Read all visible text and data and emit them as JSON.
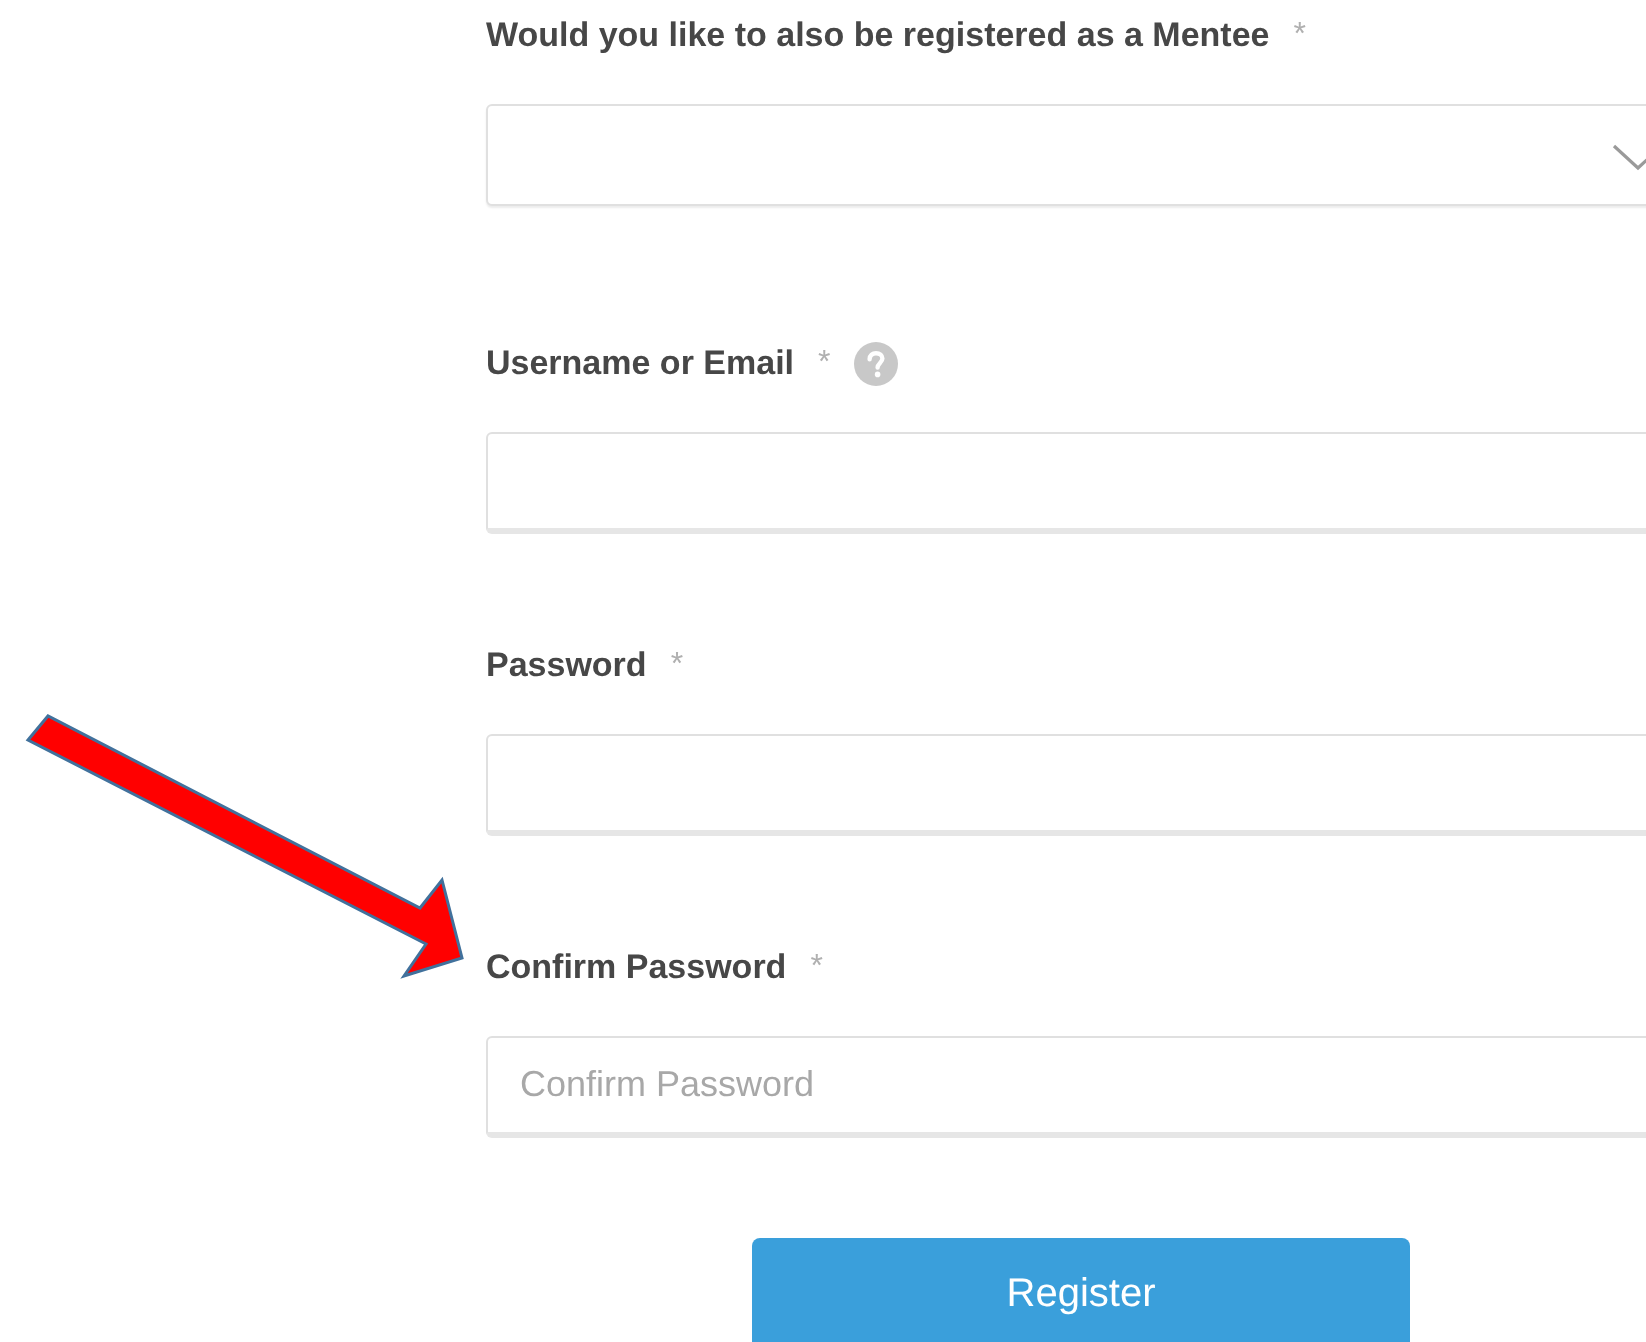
{
  "fields": [
    {
      "kind": "select",
      "label": "Would you like to also be registered as a Mentee",
      "required_mark": "*",
      "help": false
    },
    {
      "kind": "text",
      "label": "Username or Email",
      "required_mark": "*",
      "help": true
    },
    {
      "kind": "text",
      "label": "Password",
      "required_mark": "*",
      "help": false
    },
    {
      "kind": "text",
      "label": "Confirm Password",
      "required_mark": "*",
      "help": false,
      "placeholder": "Confirm Password"
    }
  ],
  "submit_button": {
    "label": "Register"
  }
}
